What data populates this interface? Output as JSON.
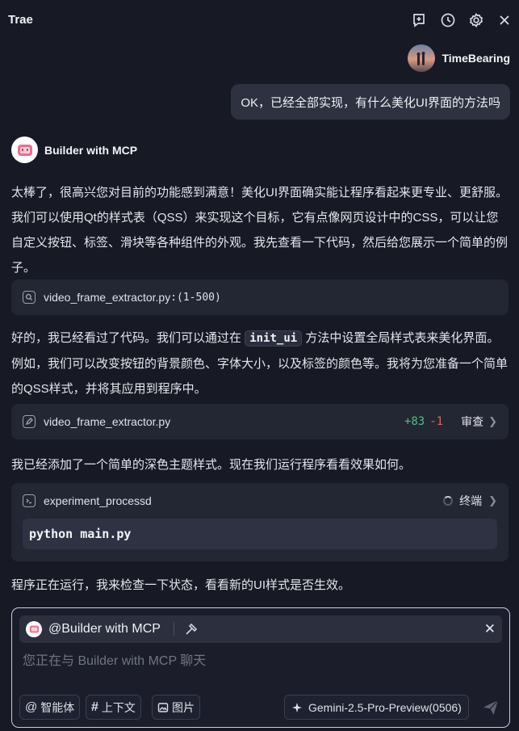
{
  "header": {
    "title": "Trae",
    "icons": [
      "new-chat-icon",
      "history-icon",
      "settings-icon",
      "close-icon"
    ]
  },
  "user": {
    "name": "TimeBearing",
    "message": "OK，已经全部实现，有什么美化UI界面的方法吗"
  },
  "assistant": {
    "name": "Builder with MCP",
    "para1": "太棒了，很高兴您对目前的功能感到满意！美化UI界面确实能让程序看起来更专业、更舒服。我们可以使用Qt的样式表（QSS）来实现这个目标，它有点像网页设计中的CSS，可以让您自定义按钮、标签、滑块等各种组件的外观。我先查看一下代码，然后给您展示一个简单的例子。",
    "search_card": {
      "file": "video_frame_extractor.py",
      "range": ":(1-500)"
    },
    "para2_before": "好的，我已经看过了代码。我们可以通过在",
    "para2_code": "init_ui",
    "para2_after": "方法中设置全局样式表来美化界面。例如，我们可以改变按钮的背景颜色、字体大小，以及标签的颜色等。我将为您准备一个简单的QSS样式，并将其应用到程序中。",
    "edit_card": {
      "file": "video_frame_extractor.py",
      "added": "+83",
      "removed": "-1",
      "review_label": "审查"
    },
    "para3": "我已经添加了一个简单的深色主题样式。现在我们运行程序看看效果如何。",
    "terminal_card": {
      "name": "experiment_processd",
      "status": "终端",
      "command": "python main.py"
    },
    "para4": "程序正在运行，我来检查一下状态，看看新的UI样式是否生效。"
  },
  "input": {
    "mention": "@Builder with MCP",
    "placeholder": "您正在与 Builder with MCP 聊天",
    "value": "",
    "chips": {
      "agent": "智能体",
      "context": "上下文",
      "image": "图片"
    },
    "model": "Gemini-2.5-Pro-Preview(0506)"
  },
  "colors": {
    "background": "#171924",
    "card": "#232633",
    "added": "#4fbf86",
    "removed": "#e4605f",
    "focus_border": "#cfc7f0"
  }
}
